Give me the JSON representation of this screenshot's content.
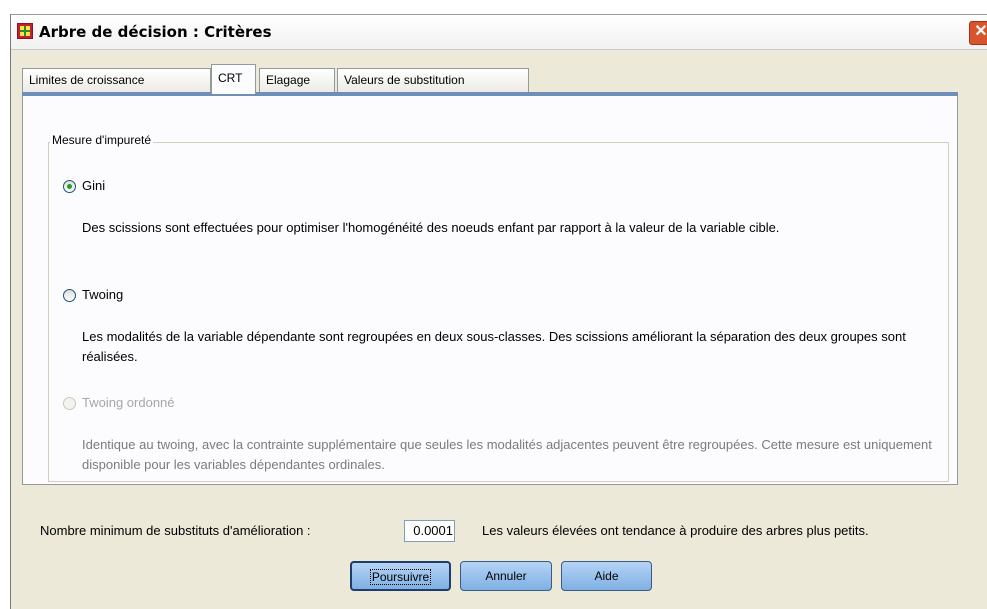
{
  "window": {
    "title": "Arbre de décision : Critères",
    "icon": "spreadsheet-icon",
    "close_glyph": "✕"
  },
  "tabs": [
    {
      "label": "Limites de croissance"
    },
    {
      "label": "CRT",
      "active": true
    },
    {
      "label": "Elagage"
    },
    {
      "label": "Valeurs de substitution"
    }
  ],
  "impurity": {
    "legend": "Mesure d'impureté",
    "options": [
      {
        "label": "Gini",
        "selected": true,
        "enabled": true,
        "description": "Des scissions sont effectuées pour optimiser l'homogénéité des noeuds enfant par rapport à la valeur de la variable cible."
      },
      {
        "label": "Twoing",
        "selected": false,
        "enabled": true,
        "description": "Les modalités de la variable dépendante sont regroupées en deux sous-classes. Des scissions améliorant la séparation des deux groupes sont réalisées."
      },
      {
        "label": "Twoing ordonné",
        "selected": false,
        "enabled": false,
        "description": "Identique au twoing, avec la contrainte supplémentaire que seules les modalités adjacentes peuvent être regroupées. Cette mesure est uniquement disponible pour les variables dépendantes ordinales."
      }
    ]
  },
  "min_improvement": {
    "label": "Nombre minimum de substituts d'amélioration :",
    "value": "0.0001",
    "hint": "Les valeurs élevées ont tendance à produire des arbres plus petits."
  },
  "buttons": {
    "continue": "Poursuivre",
    "cancel": "Annuler",
    "help": "Aide"
  },
  "colors": {
    "dialog_bg": "#ece9d8",
    "tab_underline": "#6e8fb8",
    "button_blue": "#9ec4ee",
    "radio_checked": "#21a121"
  }
}
